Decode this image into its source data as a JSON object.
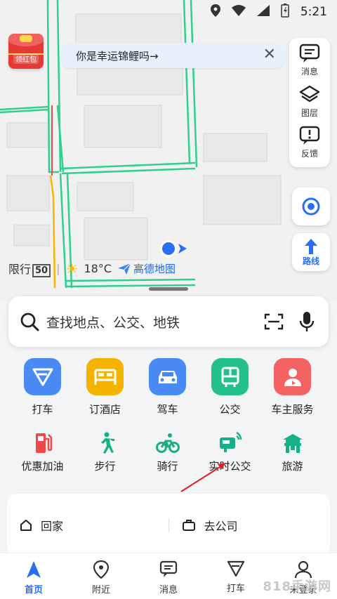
{
  "status_bar": {
    "time": "5:21"
  },
  "map": {
    "red_packet_label": "领红包",
    "banner_text": "你是幸运锦鲤吗→",
    "banner_close": "✕",
    "sidebar": [
      {
        "label": "消息",
        "icon": "message-icon"
      },
      {
        "label": "图层",
        "icon": "layers-icon"
      },
      {
        "label": "反馈",
        "icon": "feedback-icon"
      }
    ],
    "route_label": "路线",
    "traffic_limit_label": "限行",
    "traffic_limit_number": "50",
    "temperature": "18°C",
    "brand": "高德地图"
  },
  "search": {
    "placeholder": "查找地点、公交、地铁"
  },
  "services_row1": [
    {
      "label": "打车",
      "color": "#4a8af4",
      "icon": "taxi-icon"
    },
    {
      "label": "订酒店",
      "color": "#f5b300",
      "icon": "hotel-icon"
    },
    {
      "label": "驾车",
      "color": "#4a8af4",
      "icon": "car-icon"
    },
    {
      "label": "公交",
      "color": "#22c08b",
      "icon": "bus-icon"
    },
    {
      "label": "车主服务",
      "color": "#f46262",
      "icon": "car-owner-icon"
    }
  ],
  "services_row2": [
    {
      "label": "优惠加油",
      "color": "#f04848",
      "icon": "gas-icon"
    },
    {
      "label": "步行",
      "color": "#16b087",
      "icon": "walk-icon"
    },
    {
      "label": "骑行",
      "color": "#16b087",
      "icon": "bike-icon"
    },
    {
      "label": "实时公交",
      "color": "#16b087",
      "icon": "realtime-bus-icon"
    },
    {
      "label": "旅游",
      "color": "#16b087",
      "icon": "travel-icon"
    }
  ],
  "quick_actions": {
    "home": "回家",
    "work": "去公司"
  },
  "bottom_nav": [
    {
      "label": "首页",
      "active": true
    },
    {
      "label": "附近",
      "active": false
    },
    {
      "label": "消息",
      "active": false
    },
    {
      "label": "打车",
      "active": false
    },
    {
      "label": "未登录",
      "active": false
    }
  ],
  "watermark": "818手游网",
  "colors": {
    "accent": "#2a6ef6",
    "road": "#2ed18c",
    "rail": "#f5b400"
  }
}
